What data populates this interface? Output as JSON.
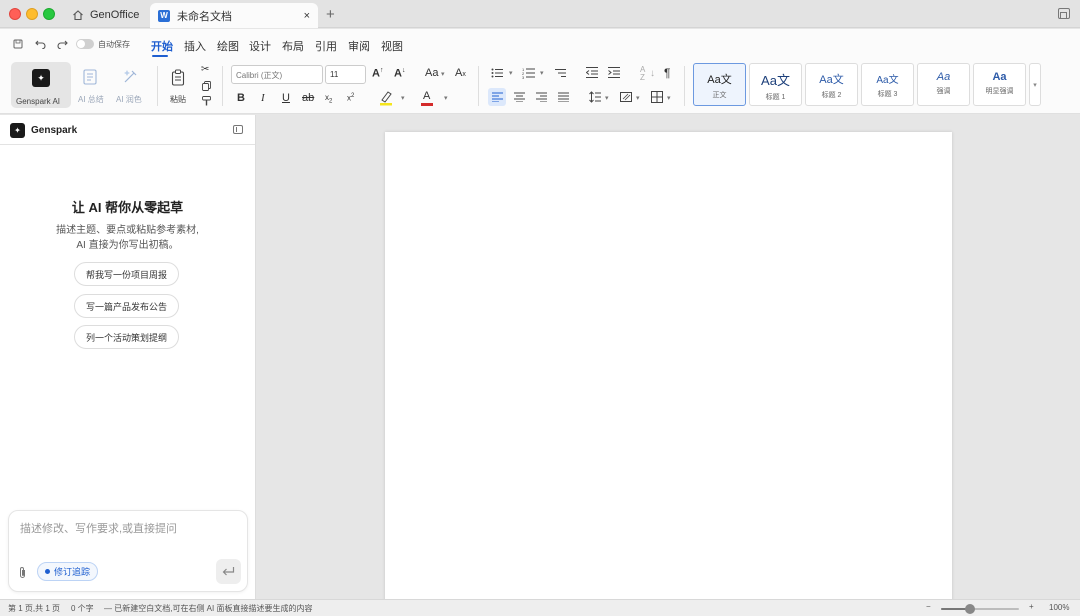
{
  "window": {
    "tabs": [
      {
        "label": "GenOffice",
        "icon": "home-icon"
      },
      {
        "label": "未命名文档",
        "icon": "word-doc-icon",
        "badge": "W",
        "close": "×"
      }
    ],
    "add_tab": "+"
  },
  "menu": {
    "autosave_label": "自动保存",
    "autosave_on": false,
    "items": [
      "开始",
      "插入",
      "绘图",
      "设计",
      "布局",
      "引用",
      "审阅",
      "视图"
    ],
    "active": "开始"
  },
  "ribbon": {
    "genspark_ai": "Genspark AI",
    "ai_summary": "AI 总结",
    "ai_polish": "AI 润色",
    "paste": "粘贴",
    "font_name": "Calibri (正文)",
    "font_size": "11",
    "styles": [
      {
        "sample": "Aa文",
        "name": "正文"
      },
      {
        "sample": "Aa文",
        "name": "标题 1"
      },
      {
        "sample": "Aa文",
        "name": "标题 2"
      },
      {
        "sample": "Aa文",
        "name": "标题 3"
      },
      {
        "sample": "Aa",
        "name": "强调"
      },
      {
        "sample": "Aa",
        "name": "明显强调"
      }
    ],
    "highlight_color": "#f5e51c",
    "font_color": "#d42b2b",
    "accent": "#1f5fd0"
  },
  "panel": {
    "title": "Genspark",
    "heading": "让 AI 帮你从零起草",
    "desc_line1": "描述主题、要点或粘贴参考素材,",
    "desc_line2": "AI 直接为你写出初稿。",
    "suggestions": [
      "帮我写一份项目周报",
      "写一篇产品发布公告",
      "列一个活动策划提纲"
    ],
    "input_placeholder": "描述修改、写作要求,或直接提问",
    "track_changes": "修订追踪"
  },
  "status": {
    "page_info": "第 1 页,共 1 页",
    "word_count": "0 个字",
    "message": "— 已新建空白文档,可在右侧 AI 面板直接描述要生成的内容",
    "zoom_minus": "−",
    "zoom_plus": "+",
    "zoom": "100%",
    "zoom_level": 0.37
  }
}
